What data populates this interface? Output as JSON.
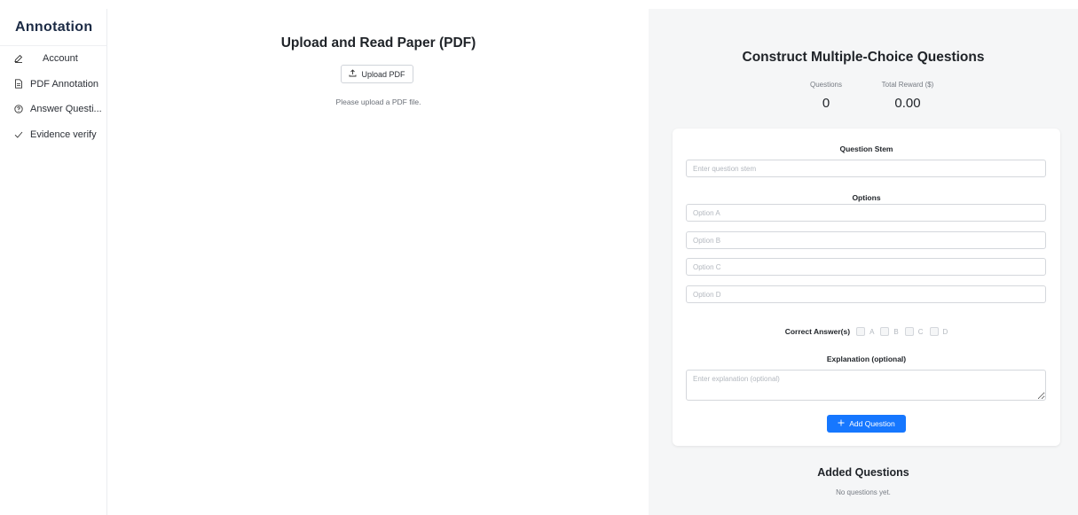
{
  "sidebar": {
    "brand": "Annotation",
    "items": [
      {
        "label": "Account",
        "icon": "pencil-icon"
      },
      {
        "label": "PDF Annotation",
        "icon": "document-icon"
      },
      {
        "label": "Answer Questi...",
        "icon": "question-circle-icon"
      },
      {
        "label": "Evidence verify",
        "icon": "check-icon"
      }
    ]
  },
  "reader": {
    "title": "Upload and Read Paper (PDF)",
    "upload_label": "Upload PDF",
    "hint": "Please upload a PDF file."
  },
  "builder": {
    "title": "Construct Multiple-Choice Questions",
    "stats": {
      "questions_caption": "Questions",
      "questions_value": "0",
      "reward_caption": "Total Reward ($)",
      "reward_value": "0.00"
    },
    "stem_label": "Question Stem",
    "stem_placeholder": "Enter question stem",
    "options_label": "Options",
    "option_placeholders": [
      "Option A",
      "Option B",
      "Option C",
      "Option D"
    ],
    "correct_label": "Correct Answer(s)",
    "answer_choices": [
      "A",
      "B",
      "C",
      "D"
    ],
    "explanation_label": "Explanation (optional)",
    "explanation_placeholder": "Enter explanation (optional)",
    "add_label": "Add Question",
    "accent_color": "#1677ff"
  },
  "added": {
    "title": "Added Questions",
    "empty": "No questions yet."
  }
}
